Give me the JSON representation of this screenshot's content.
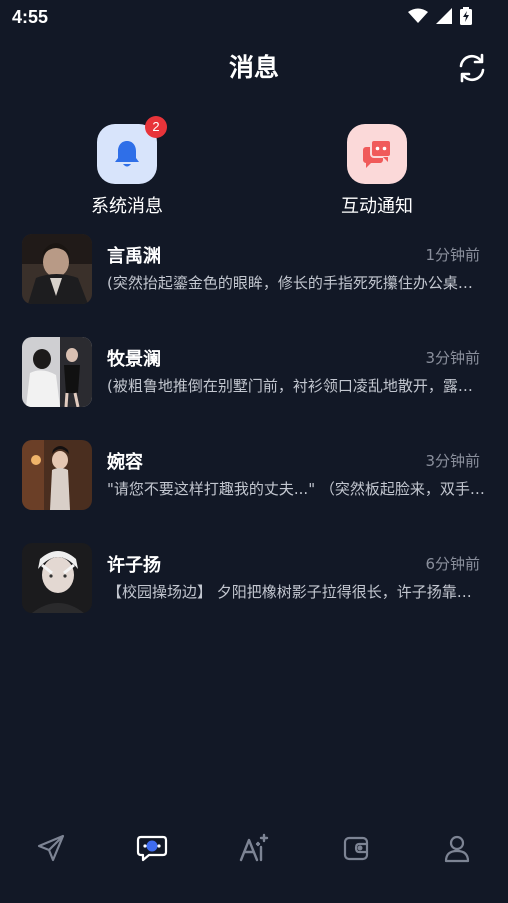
{
  "status_bar": {
    "time": "4:55"
  },
  "header": {
    "title": "消息"
  },
  "quick_actions": [
    {
      "label": "系统消息",
      "badge": "2",
      "icon": "bell-icon",
      "bg": "#d8e4fb",
      "fg": "#2f6fe8"
    },
    {
      "label": "互动通知",
      "icon": "chat-bubbles-icon",
      "bg": "#fbd9d9",
      "fg": "#f05a5a"
    }
  ],
  "conversations": [
    {
      "name": "言禹渊",
      "time": "1分钟前",
      "preview": "(突然抬起鎏金色的眼眸，修长的手指死死攥住办公桌边缘"
    },
    {
      "name": "牧景澜",
      "time": "3分钟前",
      "preview": "(被粗鲁地推倒在别墅门前，衬衫领口凌乱地散开，露出锁骨"
    },
    {
      "name": "婉容",
      "time": "3分钟前",
      "preview": "\"请您不要这样打趣我的丈夫...\" （突然板起脸来，双手叉腰"
    },
    {
      "name": "许子扬",
      "time": "6分钟前",
      "preview": "【校园操场边】 夕阳把橡树影子拉得很长，许子扬靠在看台"
    }
  ],
  "colors": {
    "background": "#121826",
    "muted": "#8a8f9c",
    "badge": "#e8343a",
    "tab_active": "#3f6cf0"
  },
  "tab_bar": [
    {
      "icon": "send-icon"
    },
    {
      "icon": "messages-icon",
      "active": true
    },
    {
      "icon": "ai-sparkle-icon"
    },
    {
      "icon": "wallet-icon"
    },
    {
      "icon": "profile-icon"
    }
  ]
}
